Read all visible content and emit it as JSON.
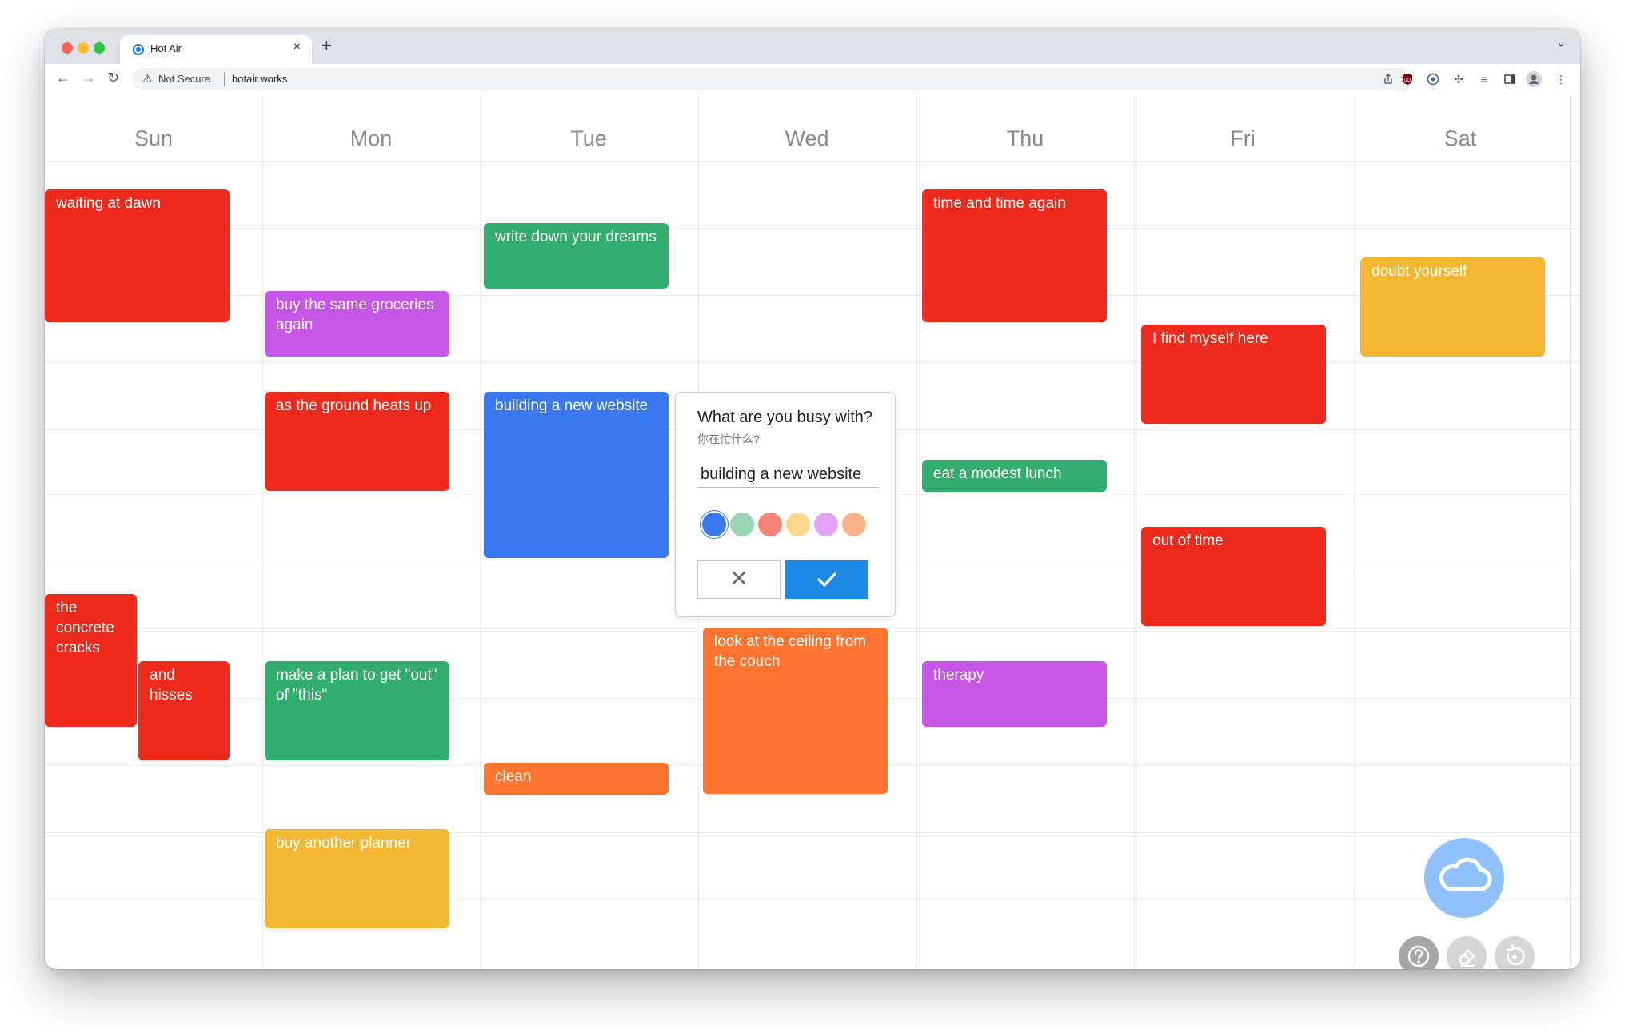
{
  "browser": {
    "tab_title": "Hot Air",
    "tab_close": "×",
    "new_tab": "+",
    "tab_menu": "⌄",
    "back": "←",
    "forward": "→",
    "reload": "↻",
    "security_label": "Not Secure",
    "url": "hotair.works"
  },
  "calendar": {
    "days": [
      "Sun",
      "Mon",
      "Tue",
      "Wed",
      "Thu",
      "Fri",
      "Sat"
    ],
    "events": [
      {
        "text": "waiting at dawn",
        "color": "#ee2a1d"
      },
      {
        "text": "the concrete cracks",
        "color": "#ee2a1d"
      },
      {
        "text": "and hisses",
        "color": "#ee2a1d"
      },
      {
        "text": "buy the same groceries again",
        "color": "#c656e5"
      },
      {
        "text": "as the ground heats up",
        "color": "#ee2a1d"
      },
      {
        "text": "make a plan to get \"out\" of \"this\"",
        "color": "#32ad6d"
      },
      {
        "text": "buy another planner",
        "color": "#f4b733"
      },
      {
        "text": "write down your dreams",
        "color": "#32ad6d"
      },
      {
        "text": "building a new website",
        "color": "#3978ee"
      },
      {
        "text": "clean",
        "color": "#ff7530"
      },
      {
        "text": "look at the ceiling from the couch",
        "color": "#ff7530"
      },
      {
        "text": "time and time again",
        "color": "#ee2a1d"
      },
      {
        "text": "eat a modest lunch",
        "color": "#32ad6d"
      },
      {
        "text": "therapy",
        "color": "#c656e5"
      },
      {
        "text": "I find myself here",
        "color": "#ee2a1d"
      },
      {
        "text": "out of time",
        "color": "#ee2a1d"
      },
      {
        "text": "doubt yourself",
        "color": "#f4b733"
      }
    ]
  },
  "dialog": {
    "title": "What are you busy with?",
    "subtitle": "你在忙什么?",
    "input_value": "building a new website",
    "swatches": [
      "#3978ee",
      "#98d7b5",
      "#f58677",
      "#fbd78f",
      "#e3a5f3",
      "#fbb38b"
    ],
    "cancel_label": "✕"
  },
  "colors": {
    "accent": "#1e88e5",
    "cloud_button": "#90c1fb"
  }
}
